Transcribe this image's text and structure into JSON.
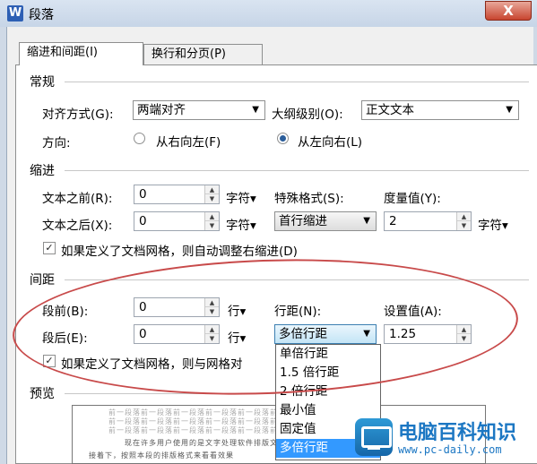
{
  "window": {
    "title": "段落",
    "app_icon_letter": "W",
    "close_glyph": "X"
  },
  "tabs": [
    {
      "label": "缩进和间距(I)"
    },
    {
      "label": "换行和分页(P)"
    }
  ],
  "general": {
    "heading": "常规",
    "alignment_label": "对齐方式(G):",
    "alignment_value": "两端对齐",
    "outline_label": "大纲级别(O):",
    "outline_value": "正文文本",
    "direction_label": "方向:",
    "rtl_label": "从右向左(F)",
    "ltr_label": "从左向右(L)",
    "direction_selected": "ltr"
  },
  "indent": {
    "heading": "缩进",
    "before_label": "文本之前(R):",
    "before_value": "0",
    "before_unit": "字符▾",
    "after_label": "文本之后(X):",
    "after_value": "0",
    "after_unit": "字符▾",
    "special_label": "特殊格式(S):",
    "special_value": "首行缩进",
    "measure_label": "度量值(Y):",
    "measure_value": "2",
    "measure_unit": "字符▾",
    "auto_adjust_label": "如果定义了文档网格，则自动调整右缩进(D)",
    "auto_adjust_checked": true
  },
  "spacing": {
    "heading": "间距",
    "before_label": "段前(B):",
    "before_value": "0",
    "before_unit": "行▾",
    "after_label": "段后(E):",
    "after_value": "0",
    "after_unit": "行▾",
    "line_label": "行距(N):",
    "line_value": "多倍行距",
    "setting_label": "设置值(A):",
    "setting_value": "1.25",
    "grid_label": "如果定义了文档网格，则与网格对",
    "grid_checked": true,
    "line_options": [
      "单倍行距",
      "1.5 倍行距",
      "2 倍行距",
      "最小值",
      "固定值",
      "多倍行距"
    ],
    "line_selected_index": 5
  },
  "preview": {
    "heading": "预览",
    "sample_prev": "前一段落前一段落前一段落前一段落前一段落前一段落前一段落",
    "sample_cur1": "现在许多用户使用的是文字处理软件排版文档",
    "sample_cur2": "接着下，按照本段的排版格式来看看效果"
  },
  "watermark": {
    "text": "电脑百科知识",
    "url": "www.pc-daily.com"
  },
  "colors": {
    "annotation": "#c84a4a",
    "selection": "#3399ff",
    "brand": "#1c77c3"
  }
}
